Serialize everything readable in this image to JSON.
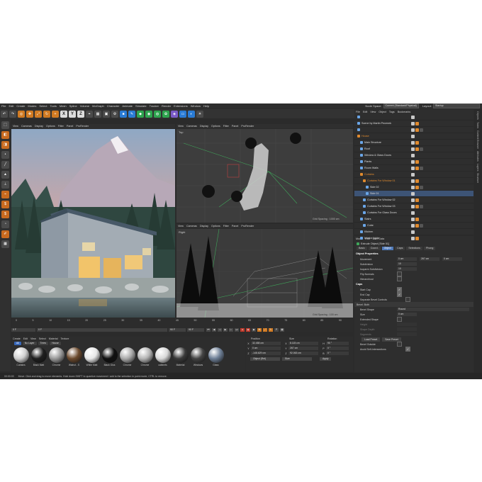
{
  "menu": [
    "File",
    "Edit",
    "Create",
    "Modes",
    "Select",
    "Tools",
    "Mesh",
    "Spline",
    "Volume",
    "MoGraph",
    "Character",
    "Animate",
    "Simulate",
    "Tracker",
    "Render",
    "Extensions",
    "Window",
    "Help"
  ],
  "node_space_label": "Node Space:",
  "node_space_value": "Current (Standard/Physical)",
  "layout_label": "Layout:",
  "layout_value": "Startup",
  "toolbar_axes": [
    "X",
    "Y",
    "Z"
  ],
  "viewport_menu": [
    "View",
    "Cameras",
    "Display",
    "Options",
    "Filter",
    "Panel",
    "ProRender"
  ],
  "viewports": {
    "top_label": "Top",
    "right_label": "Right",
    "grid_spacing": "Grid Spacing : 1000 cm",
    "grid_spacing_right": "Grid Spacing : 100 cm"
  },
  "timeline": {
    "ticks": [
      "0",
      "5",
      "10",
      "15",
      "20",
      "25",
      "30",
      "35",
      "40",
      "45",
      "50",
      "55",
      "60",
      "65",
      "70",
      "75",
      "80",
      "85",
      "90"
    ],
    "start": "0 F",
    "current": "0 F",
    "end": "90 F",
    "end2": "90 F",
    "frame_right": "0 F"
  },
  "materials_menu": [
    "Create",
    "Edit",
    "View",
    "Select",
    "Material",
    "Texture"
  ],
  "materials_filter": [
    "All",
    "No Layer",
    "Trees",
    "House"
  ],
  "materials": [
    {
      "name": "Curtains",
      "color": "#cfcfcf"
    },
    {
      "name": "Black Matt",
      "color": "#1f1f1f"
    },
    {
      "name": "Chrome",
      "color": "#9a9a9a"
    },
    {
      "name": "Walnut - S",
      "color": "#6b4a2e"
    },
    {
      "name": "White Matt",
      "color": "#e8e8e8"
    },
    {
      "name": "Black Glos",
      "color": "#111111"
    },
    {
      "name": "Chrome",
      "color": "#aaaaaa"
    },
    {
      "name": "Chrome",
      "color": "#b5b5b5"
    },
    {
      "name": "cabinets",
      "color": "#d8d8d8"
    },
    {
      "name": "Material",
      "color": "#3a3a3a"
    },
    {
      "name": "Windows",
      "color": "#444444"
    },
    {
      "name": "Glass",
      "color": "#6e7f96"
    }
  ],
  "coordinates": {
    "headers": [
      "Position",
      "Size",
      "Rotation"
    ],
    "rows": [
      {
        "axis": "X",
        "pos": "32.458 cm",
        "size": "8.115 cm",
        "rot_axis": "H",
        "rot": "90 °"
      },
      {
        "axis": "Y",
        "pos": "0 cm",
        "size": "267 cm",
        "rot_axis": "P",
        "rot": "0 °"
      },
      {
        "axis": "Z",
        "pos": "-148.629 cm",
        "size": "92.063 cm",
        "rot_axis": "B",
        "rot": "0 °"
      }
    ],
    "mode": "Object (Rel)",
    "size_mode": "Size",
    "apply": "Apply"
  },
  "status_time": "00:00:03",
  "status_text": "Move: Click and drag to move elements. Hold down SHIFT to quantize movement / add to the selection in point mode, CTRL to remove.",
  "object_manager": {
    "menu": [
      "File",
      "Edit",
      "View",
      "Object",
      "Tags",
      "Bookmarks"
    ],
    "rows": [
      {
        "name": "",
        "level": 0,
        "selected": false,
        "orange": false
      },
      {
        "name": "Scene by Martin Pecenek",
        "level": 0,
        "selected": false,
        "orange": false
      },
      {
        "name": "",
        "level": 0,
        "selected": false,
        "orange": false
      },
      {
        "name": "House",
        "level": 0,
        "selected": false,
        "orange": true
      },
      {
        "name": "Main Structure",
        "level": 1,
        "selected": false,
        "orange": false
      },
      {
        "name": "Roof",
        "level": 1,
        "selected": false,
        "orange": false
      },
      {
        "name": "Window & Glass Doors",
        "level": 1,
        "selected": false,
        "orange": false
      },
      {
        "name": "Plants",
        "level": 1,
        "selected": false,
        "orange": false
      },
      {
        "name": "Room Walls",
        "level": 1,
        "selected": false,
        "orange": false
      },
      {
        "name": "Curtains",
        "level": 1,
        "selected": false,
        "orange": true
      },
      {
        "name": "Curtains For Window 01",
        "level": 2,
        "selected": false,
        "orange": true
      },
      {
        "name": "Side 02",
        "level": 3,
        "selected": false,
        "orange": false
      },
      {
        "name": "Side 01",
        "level": 3,
        "selected": true,
        "orange": false
      },
      {
        "name": "Curtains For Window 02",
        "level": 2,
        "selected": false,
        "orange": false
      },
      {
        "name": "Curtains For Window 03",
        "level": 2,
        "selected": false,
        "orange": false
      },
      {
        "name": "Curtains For Glass Doors",
        "level": 2,
        "selected": false,
        "orange": false
      },
      {
        "name": "Stairs",
        "level": 1,
        "selected": false,
        "orange": false
      },
      {
        "name": "Cube",
        "level": 2,
        "selected": false,
        "orange": false
      },
      {
        "name": "Kitchen",
        "level": 1,
        "selected": false,
        "orange": false
      },
      {
        "name": "Interior lights",
        "level": 1,
        "selected": false,
        "orange": false
      }
    ]
  },
  "attributes": {
    "menu": [
      "Mode",
      "Edit",
      "User Data"
    ],
    "title": "Extrude Object [Side 01]",
    "tabs": [
      "Basic",
      "Coord.",
      "Object",
      "Caps",
      "Selections",
      "Phong"
    ],
    "active_tab": "Object",
    "object_section": "Object Properties",
    "object_rows": [
      {
        "label": "Movement",
        "v1": "0 cm",
        "v2": "267 cm",
        "v3": "0 cm"
      },
      {
        "label": "Subdivision",
        "v1": "10"
      },
      {
        "label": "Isoparm Subdivision",
        "v1": "10"
      }
    ],
    "flip_normals": "Flip Normals",
    "hierarchical": "Hierarchical",
    "caps_section": "Caps",
    "start_cap": "Start Cap",
    "end_cap": "End Cap",
    "separate_bevel": "Separate Bevel Controls",
    "bevel_section": "Bevel: Both",
    "bevel_shape_label": "Bevel Shape",
    "bevel_shape_value": "Round",
    "size_label": "Size",
    "size_value": "0 cm",
    "extended_shape": "Extended Shape",
    "height_label": "Height",
    "shape_depth_label": "Shape Depth",
    "segments_label": "Segments",
    "load_preset": "Load Preset",
    "save_preset": "Save Preset",
    "bevel_outside": "Bevel Outside",
    "avoid_intersections": "Avoid Self-Intersections"
  },
  "side_tabs": [
    "Objects",
    "Takes",
    "Content Browser",
    "Attributes",
    "Layers",
    "Structure"
  ]
}
